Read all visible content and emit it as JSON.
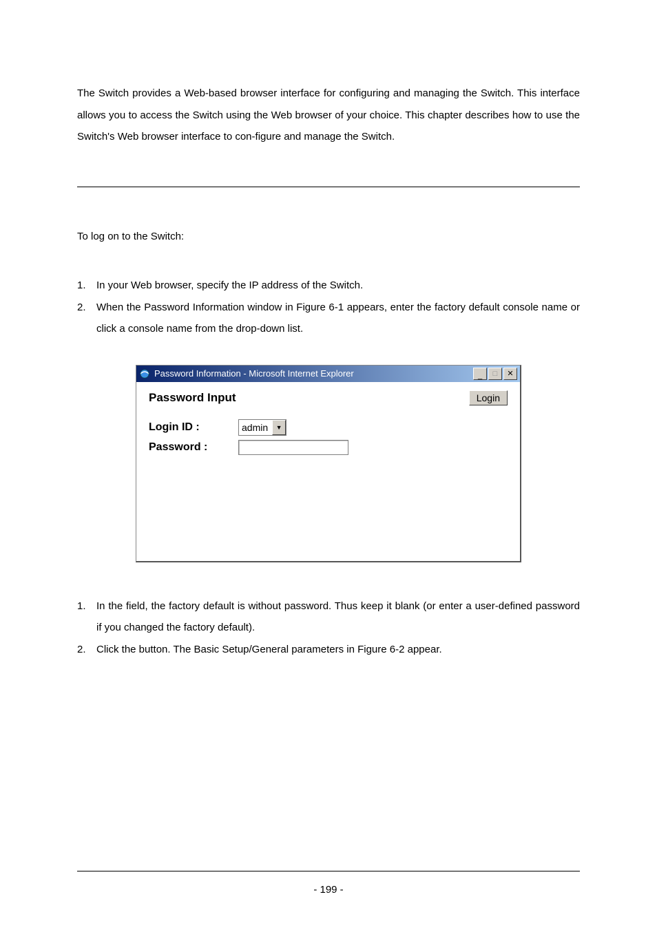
{
  "intro_paragraph": "The Switch provides a Web-based browser interface for configuring and managing the Switch. This interface allows you to access the Switch using the Web browser of your choice. This chapter describes how to use the Switch's Web browser interface to con-figure and manage the Switch.",
  "login_intro": "To log on to the Switch:",
  "steps1": [
    {
      "num": "1.",
      "text": "In your Web browser, specify the IP address of the Switch."
    },
    {
      "num": "2.",
      "text": "When the Password Information window in Figure 6-1 appears, enter the factory default console name          or click a console name from the             drop-down list."
    }
  ],
  "window": {
    "title": "Password Information - Microsoft Internet Explorer",
    "heading": "Password Input",
    "login_button": "Login",
    "login_id_label": "Login ID :",
    "password_label": "Password :",
    "login_id_value": "admin",
    "password_value": ""
  },
  "steps2": [
    {
      "num": "1.",
      "text": "In the                field, the factory default is without password.  Thus keep it blank (or enter a user-defined password if you changed the factory default)."
    },
    {
      "num": "2.",
      "text": "Click the          button. The Basic Setup/General parameters in Figure 6-2 appear."
    }
  ],
  "page_number": "- 199 -"
}
